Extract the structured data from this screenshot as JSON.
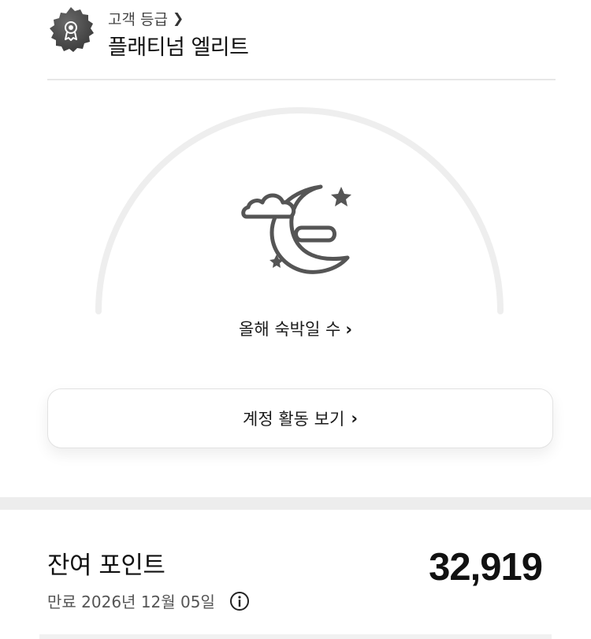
{
  "tier": {
    "caption": "고객 등급",
    "name": "플래티넘 엘리트",
    "badge_icon": "medal-badge-icon",
    "chevron_icon": "chevron-right-icon"
  },
  "stays": {
    "illustration_icon": "moon-cloud-stars-icon",
    "link_label": "올해 숙박일 수",
    "progress_fraction": 0
  },
  "activity_button": {
    "label": "계정 활동 보기"
  },
  "points": {
    "title": "잔여 포인트",
    "value": "32,919",
    "expiry": "만료 2026년 12월 05일",
    "info_icon": "info-icon"
  },
  "colors": {
    "arc_track": "#eeeeee",
    "badge": "#4d4d4d",
    "separator": "#ededed"
  }
}
